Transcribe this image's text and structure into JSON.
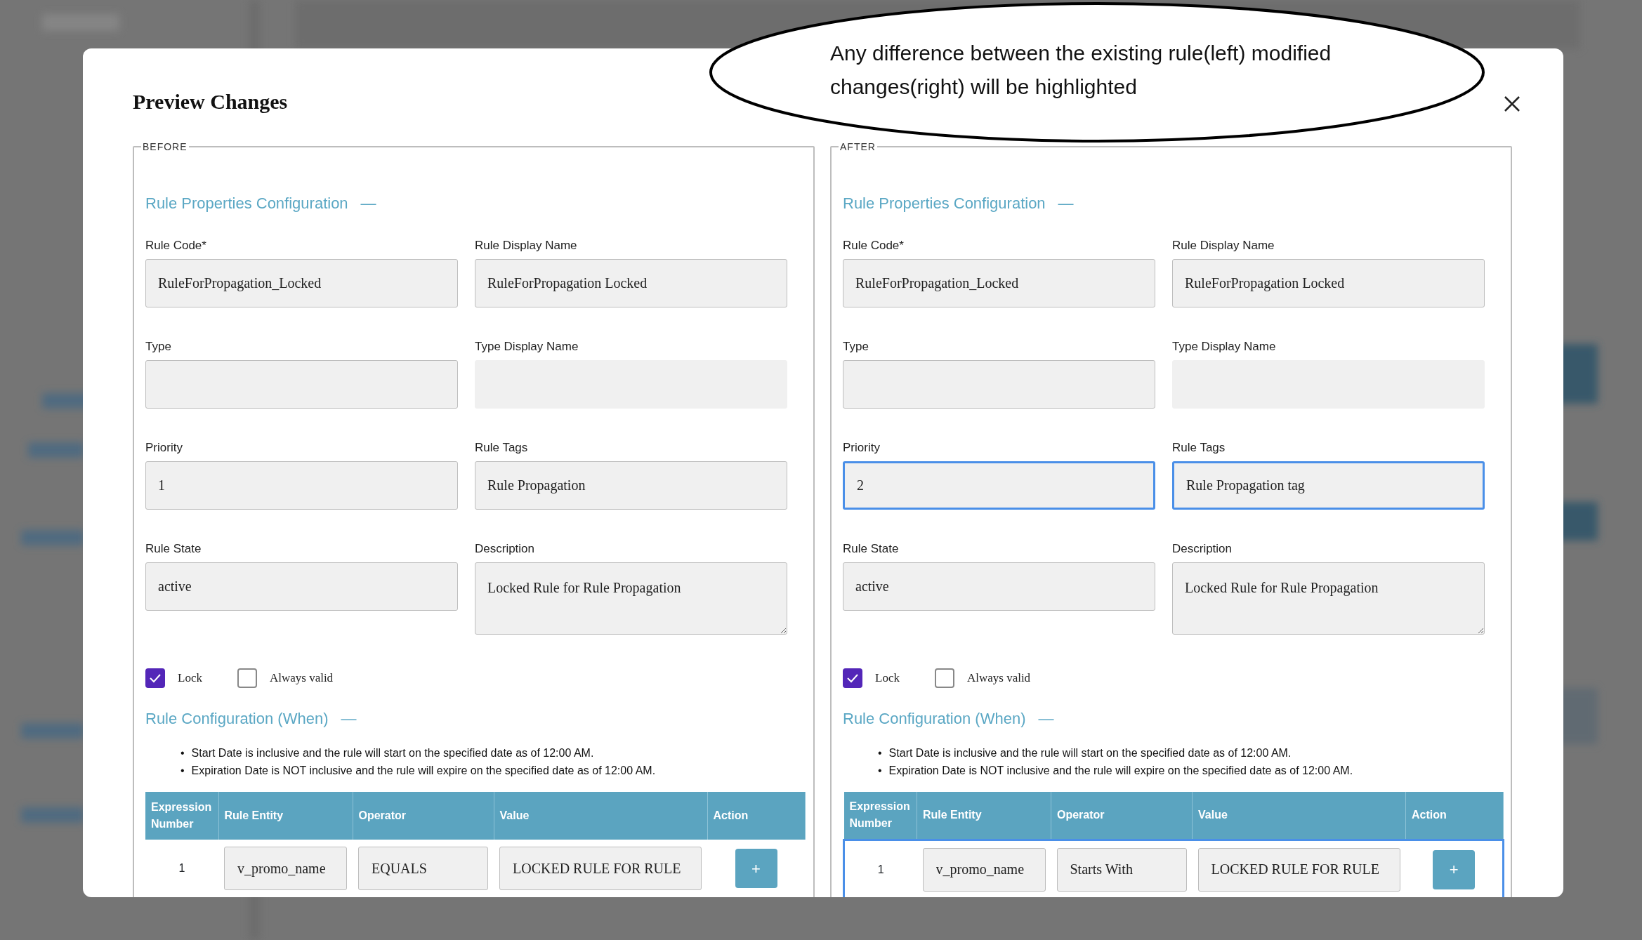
{
  "dialog": {
    "title": "Preview Changes"
  },
  "callout": {
    "text": "Any difference between the existing rule(left) modified changes(right) will be highlighted"
  },
  "panels": [
    {
      "legend": "BEFORE",
      "properties_heading": "Rule Properties Configuration",
      "properties_toggle": "—",
      "fields": [
        {
          "label": "Rule Code*",
          "value": "RuleForPropagation_Locked",
          "kind": "input",
          "disabled": false,
          "highlighted": false
        },
        {
          "label": "Rule Display Name",
          "value": "RuleForPropagation Locked",
          "kind": "input",
          "disabled": false,
          "highlighted": false
        },
        {
          "label": "Type",
          "kind": "input",
          "disabled": false,
          "highlighted": false
        },
        {
          "label": "Type Display Name",
          "kind": "input",
          "disabled": true,
          "highlighted": false
        },
        {
          "label": "Priority",
          "value": "1",
          "kind": "input",
          "disabled": false,
          "highlighted": false
        },
        {
          "label": "Rule Tags",
          "value": "Rule Propagation",
          "kind": "input",
          "disabled": false,
          "highlighted": false
        },
        {
          "label": "Rule State",
          "value": "active",
          "kind": "input",
          "disabled": false,
          "highlighted": false
        },
        {
          "label": "Description",
          "value": "Locked Rule for Rule Propagation",
          "kind": "textarea",
          "disabled": false,
          "highlighted": false
        }
      ],
      "checkboxes": [
        {
          "label": "Lock",
          "checked": true
        },
        {
          "label": "Always valid",
          "checked": false
        }
      ],
      "when_heading": "Rule Configuration (When)",
      "when_toggle": "—",
      "notes": [
        {
          "bullet": "•",
          "text": "Start Date is inclusive and the rule will start on the specified date as of 12:00 AM."
        },
        {
          "bullet": "•",
          "text": "Expiration Date is NOT inclusive and the rule will expire on the specified date as of 12:00 AM."
        }
      ],
      "table": {
        "columns": [
          "Expression Number",
          "Rule Entity",
          "Operator",
          "Value",
          "Action"
        ],
        "rows": [
          {
            "number": "1",
            "entity": "v_promo_name",
            "operator": "EQUALS",
            "value": "LOCKED RULE FOR RULE",
            "action": "+",
            "highlighted": false
          }
        ]
      }
    },
    {
      "legend": "AFTER",
      "properties_heading": "Rule Properties Configuration",
      "properties_toggle": "—",
      "fields": [
        {
          "label": "Rule Code*",
          "value": "RuleForPropagation_Locked",
          "kind": "input",
          "disabled": false,
          "highlighted": false
        },
        {
          "label": "Rule Display Name",
          "value": "RuleForPropagation Locked",
          "kind": "input",
          "disabled": false,
          "highlighted": false
        },
        {
          "label": "Type",
          "kind": "input",
          "disabled": false,
          "highlighted": false
        },
        {
          "label": "Type Display Name",
          "kind": "input",
          "disabled": true,
          "highlighted": false
        },
        {
          "label": "Priority",
          "value": "2",
          "kind": "input",
          "disabled": false,
          "highlighted": true
        },
        {
          "label": "Rule Tags",
          "value": "Rule Propagation tag",
          "kind": "input",
          "disabled": false,
          "highlighted": true
        },
        {
          "label": "Rule State",
          "value": "active",
          "kind": "input",
          "disabled": false,
          "highlighted": false
        },
        {
          "label": "Description",
          "value": "Locked Rule for Rule Propagation",
          "kind": "textarea",
          "disabled": false,
          "highlighted": false
        }
      ],
      "checkboxes": [
        {
          "label": "Lock",
          "checked": true
        },
        {
          "label": "Always valid",
          "checked": false
        }
      ],
      "when_heading": "Rule Configuration (When)",
      "when_toggle": "—",
      "notes": [
        {
          "bullet": "•",
          "text": "Start Date is inclusive and the rule will start on the specified date as of 12:00 AM."
        },
        {
          "bullet": "•",
          "text": "Expiration Date is NOT inclusive and the rule will expire on the specified date as of 12:00 AM."
        }
      ],
      "table": {
        "columns": [
          "Expression Number",
          "Rule Entity",
          "Operator",
          "Value",
          "Action"
        ],
        "rows": [
          {
            "number": "1",
            "entity": "v_promo_name",
            "operator": "Starts With",
            "value": "LOCKED RULE FOR RULE",
            "action": "+",
            "highlighted": true
          }
        ]
      }
    }
  ]
}
